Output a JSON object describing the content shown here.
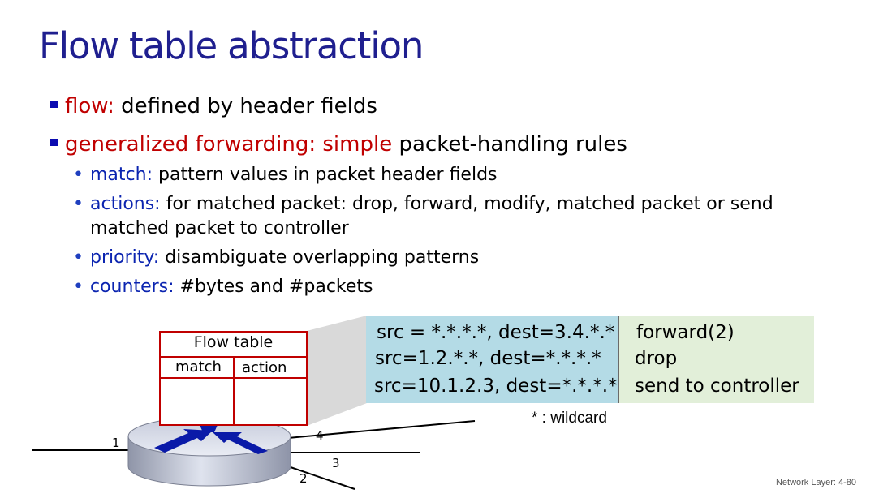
{
  "title": "Flow table abstraction",
  "bullets": {
    "flow_term": "flow:",
    "flow_text": " defined by header fields",
    "gf_term": "generalized forwarding:",
    "gf_simple": " simple",
    "gf_text": " packet-handling rules"
  },
  "sub_bullets": [
    {
      "term": "match:",
      "text": " pattern values in packet header fields"
    },
    {
      "term": "actions:",
      "text": " for matched packet: drop, forward, modify, matched packet or send matched packet to controller"
    },
    {
      "term": "priority:",
      "text": " disambiguate overlapping patterns"
    },
    {
      "term": "counters:",
      "text": " #bytes and #packets"
    }
  ],
  "rules": [
    {
      "match": "src = *.*.*.*, dest=3.4.*.*",
      "action": "forward(2)"
    },
    {
      "match": "src=1.2.*.*, dest=*.*.*.*",
      "action": "drop"
    },
    {
      "match": "src=10.1.2.3, dest=*.*.*.*",
      "action": "send to controller"
    }
  ],
  "flow_table": {
    "title": "Flow table",
    "col_match": "match",
    "col_action": "action"
  },
  "ports": {
    "p1": "1",
    "p2": "2",
    "p3": "3",
    "p4": "4"
  },
  "wildcard_note": "* : wildcard",
  "footer": "Network Layer: 4-80",
  "colors": {
    "title": "#1f1f8f",
    "term_red": "#c00000",
    "term_blue": "#0b24b0",
    "match_bg": "#b4dbe6",
    "action_bg": "#e2efd9",
    "table_border": "#c00000"
  }
}
